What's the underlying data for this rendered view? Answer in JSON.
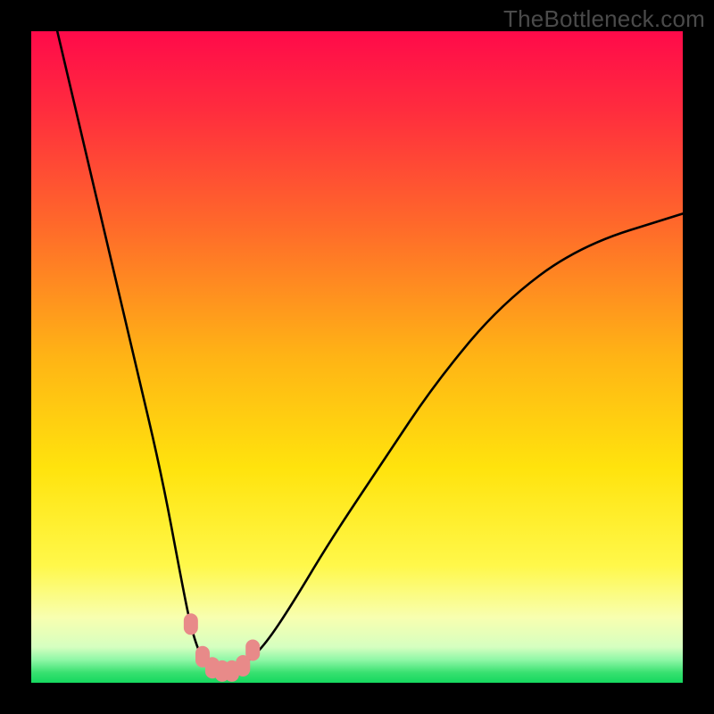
{
  "watermark": "TheBottleneck.com",
  "colors": {
    "black": "#000000",
    "curve": "#000000",
    "marker": "#e88a89",
    "gradient_stops": [
      {
        "pos": 0.0,
        "color": "#ff0a4a"
      },
      {
        "pos": 0.12,
        "color": "#ff2c3e"
      },
      {
        "pos": 0.3,
        "color": "#ff6a2a"
      },
      {
        "pos": 0.5,
        "color": "#ffb415"
      },
      {
        "pos": 0.67,
        "color": "#ffe30d"
      },
      {
        "pos": 0.82,
        "color": "#fff84a"
      },
      {
        "pos": 0.9,
        "color": "#f8ffb0"
      },
      {
        "pos": 0.945,
        "color": "#d6ffc0"
      },
      {
        "pos": 0.965,
        "color": "#8ef7a6"
      },
      {
        "pos": 0.985,
        "color": "#36e06f"
      },
      {
        "pos": 1.0,
        "color": "#15d85f"
      }
    ]
  },
  "chart_data": {
    "type": "line",
    "title": "",
    "xlabel": "",
    "ylabel": "",
    "xlim": [
      0,
      100
    ],
    "ylim": [
      0,
      100
    ],
    "series": [
      {
        "name": "bottleneck-curve",
        "x": [
          4,
          8,
          12,
          16,
          20,
          23,
          24.5,
          26,
          27.5,
          29,
          31,
          33,
          36,
          40,
          46,
          54,
          62,
          72,
          84,
          100
        ],
        "y": [
          100,
          83,
          66,
          49,
          32,
          16,
          8.5,
          4,
          2.5,
          1.8,
          2.0,
          3.0,
          6,
          12,
          22,
          34,
          46,
          58,
          67,
          72
        ]
      }
    ],
    "markers": {
      "name": "highlight-points",
      "x": [
        24.5,
        26.3,
        27.8,
        29.3,
        30.8,
        32.5,
        34.0
      ],
      "y": [
        9.0,
        4.0,
        2.3,
        1.8,
        1.8,
        2.6,
        5.0
      ]
    }
  }
}
